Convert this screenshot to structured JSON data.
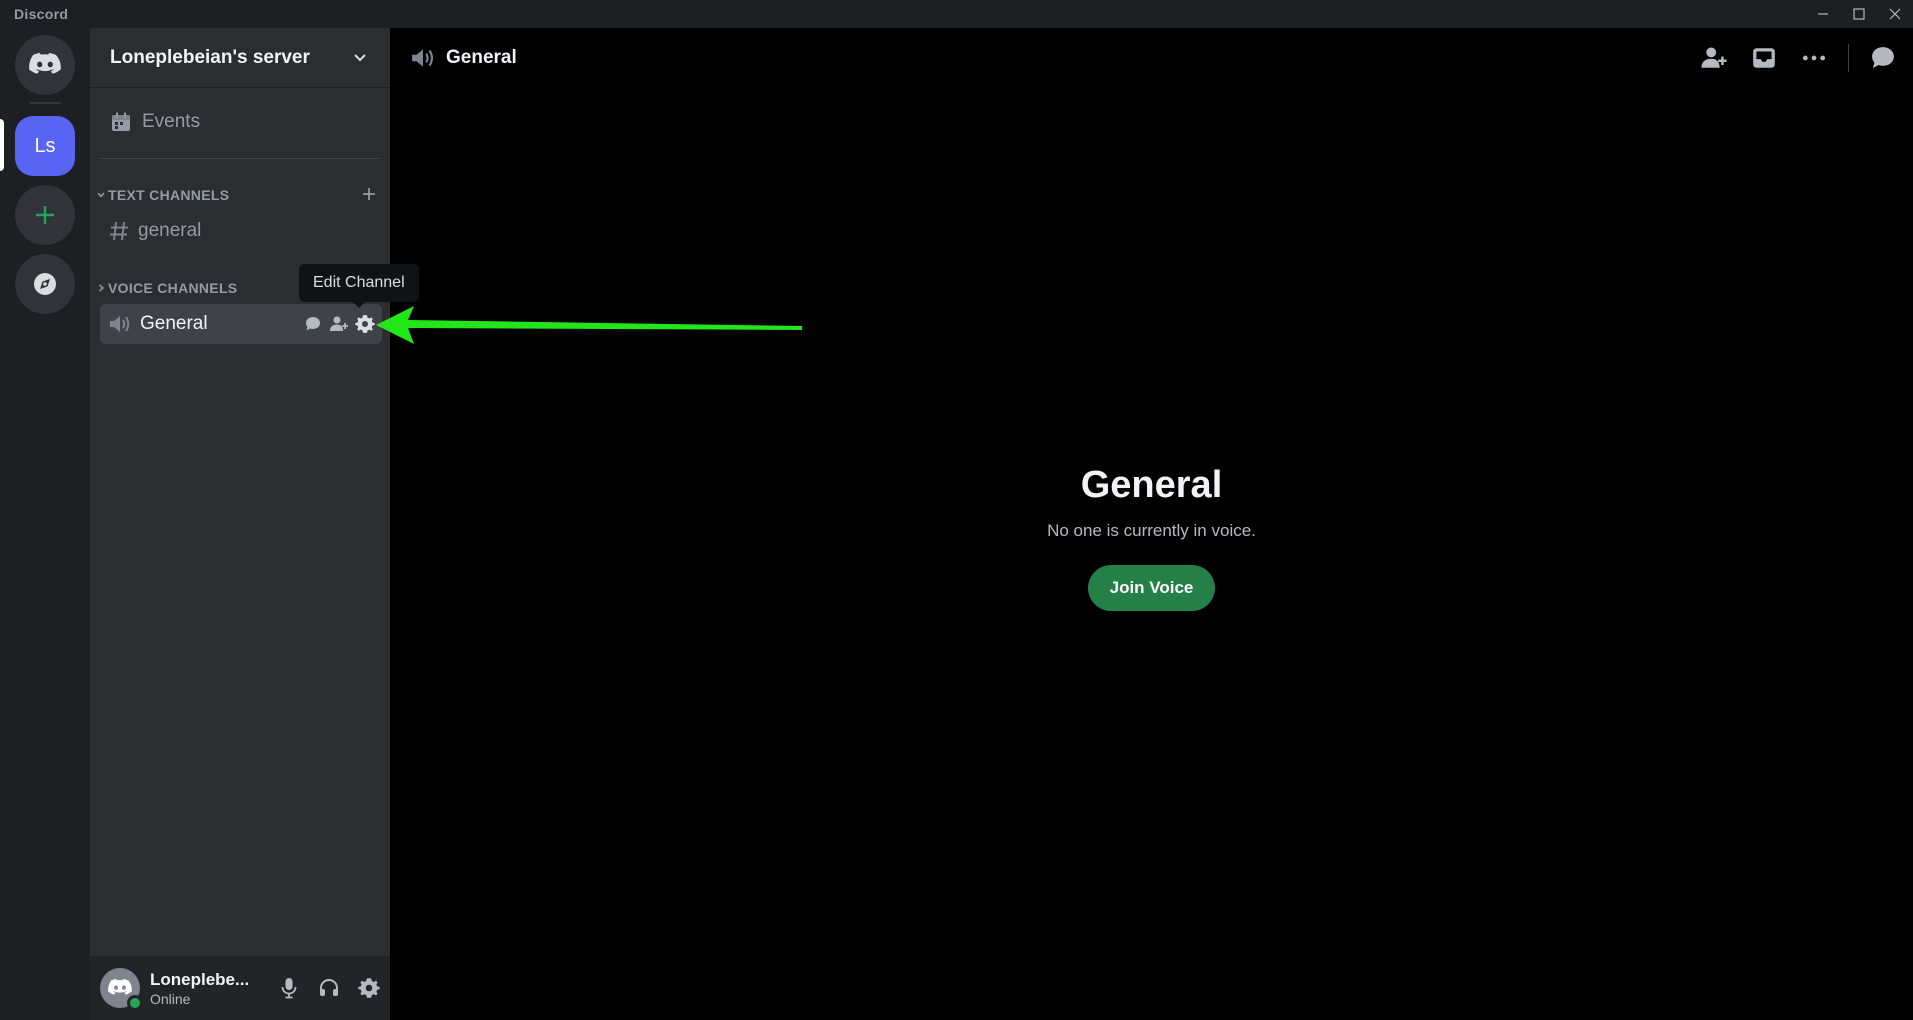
{
  "app": {
    "title": "Discord"
  },
  "window_controls": [
    "minimize",
    "maximize",
    "close"
  ],
  "server_rail": {
    "home_icon": "discord-logo-icon",
    "active_server_initials": "Ls",
    "add_server_icon": "plus-icon",
    "discover_icon": "compass-icon"
  },
  "sidebar": {
    "server_name": "Loneplebeian's server",
    "events_label": "Events",
    "text_category": "TEXT CHANNELS",
    "text_channels": [
      {
        "name": "general"
      }
    ],
    "voice_category": "VOICE CHANNELS",
    "voice_channels": [
      {
        "name": "General"
      }
    ],
    "tooltip": "Edit Channel"
  },
  "user": {
    "name": "Loneplebe...",
    "status": "Online"
  },
  "main": {
    "channel_title": "General",
    "voice_title": "General",
    "voice_subtitle": "No one is currently in voice.",
    "join_button": "Join Voice"
  },
  "colors": {
    "accent": "#5865f2",
    "online": "#23a55a",
    "join_green": "#248046",
    "annotation_arrow": "#22e61a",
    "add_server_green": "#23a55a"
  }
}
